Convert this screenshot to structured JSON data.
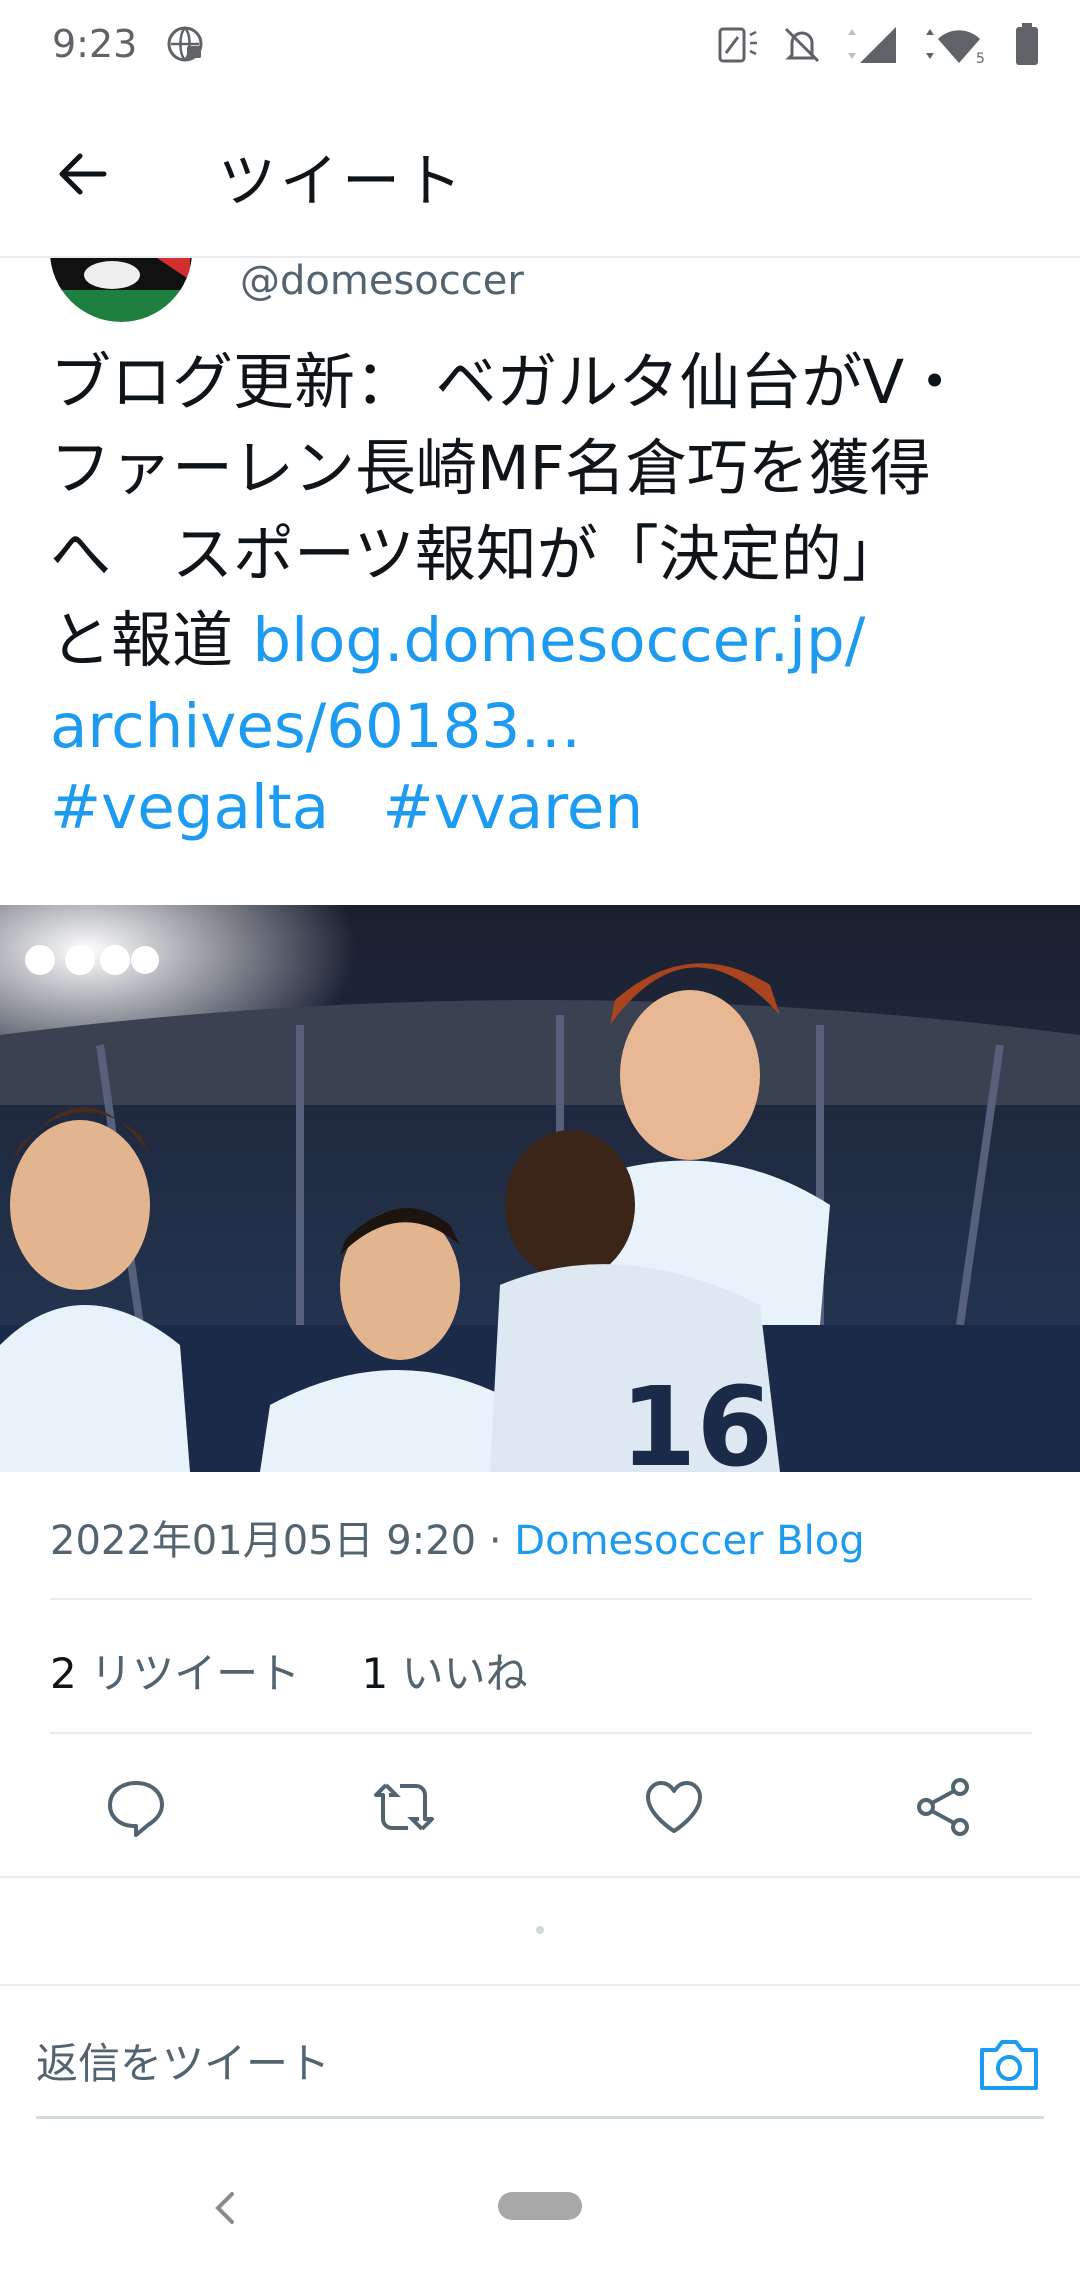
{
  "status_bar": {
    "time": "9:23"
  },
  "header": {
    "title": "ツイート"
  },
  "tweet": {
    "handle": "@domesoccer",
    "text_lines": [
      "ブログ更新： ベガルタ仙台がV・",
      "ファーレン長崎MF名倉巧を獲得",
      "へ　スポーツ報知が「決定的」",
      "と報道 "
    ],
    "link_part1": "blog.domesoccer.jp/",
    "link_part2": "archives/60183…",
    "hashtags": [
      "#vegalta",
      "#vvaren"
    ],
    "date": "2022年01月05日 9:20",
    "separator": "·",
    "source": "Domesoccer Blog",
    "retweet_count": "2",
    "retweet_label": "リツイート",
    "like_count": "1",
    "like_label": "いいね"
  },
  "reply": {
    "placeholder": "返信をツイート"
  },
  "colors": {
    "accent": "#1d9bf0",
    "muted": "#536471",
    "divider": "#e6ecf0"
  },
  "icons": [
    "back-arrow-icon",
    "reply-icon",
    "retweet-icon",
    "like-icon",
    "share-icon",
    "camera-icon"
  ]
}
